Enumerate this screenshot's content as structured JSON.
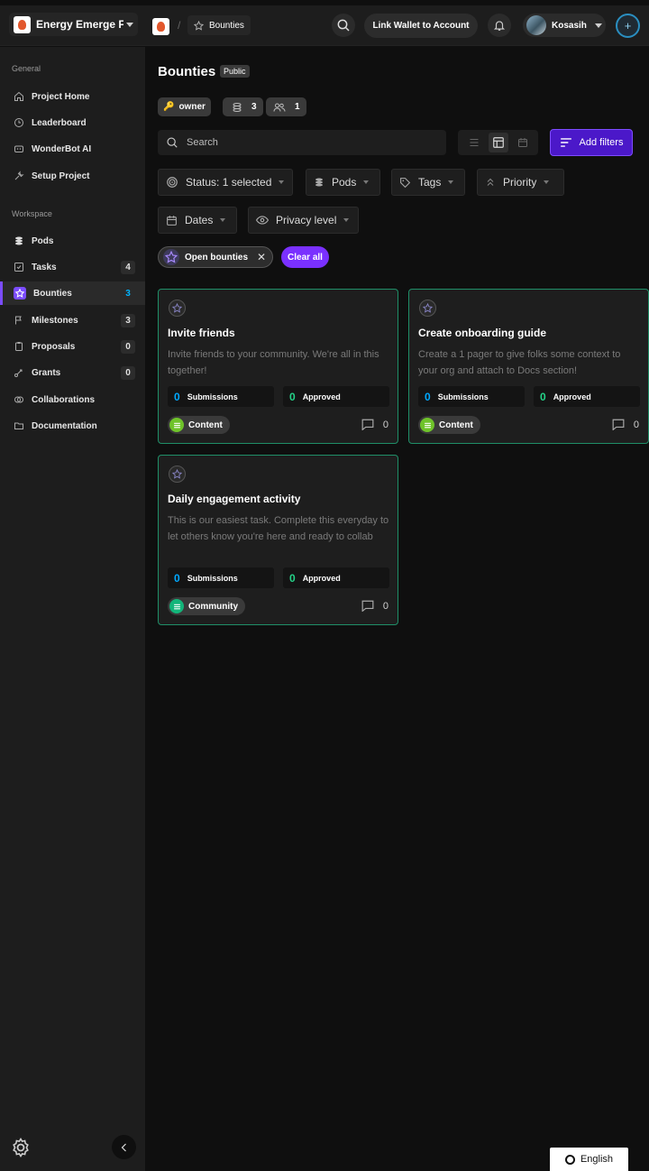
{
  "topbar": {
    "org_name": "Energy Emerge F...",
    "breadcrumb_current": "Bounties",
    "link_wallet_label": "Link Wallet to Account",
    "user_name": "Kosasih"
  },
  "sidebar": {
    "general_heading": "General",
    "general_items": [
      {
        "label": "Project Home",
        "icon": "home-icon"
      },
      {
        "label": "Leaderboard",
        "icon": "leaderboard-icon"
      },
      {
        "label": "WonderBot AI",
        "icon": "bot-icon"
      },
      {
        "label": "Setup Project",
        "icon": "wrench-icon"
      }
    ],
    "workspace_heading": "Workspace",
    "workspace_items": [
      {
        "label": "Pods",
        "icon": "pods-icon",
        "count": ""
      },
      {
        "label": "Tasks",
        "icon": "tasks-icon",
        "count": "4"
      },
      {
        "label": "Bounties",
        "icon": "star-icon",
        "count": "3"
      },
      {
        "label": "Milestones",
        "icon": "flag-icon",
        "count": "3"
      },
      {
        "label": "Proposals",
        "icon": "clipboard-icon",
        "count": "0"
      },
      {
        "label": "Grants",
        "icon": "grant-icon",
        "count": "0"
      },
      {
        "label": "Collaborations",
        "icon": "collab-icon",
        "count": ""
      },
      {
        "label": "Documentation",
        "icon": "folder-icon",
        "count": ""
      }
    ]
  },
  "header": {
    "title": "Bounties",
    "badge": "Public",
    "role_chip": "owner",
    "pods_count": "3",
    "members_count": "1"
  },
  "toolbar": {
    "search_placeholder": "Search",
    "add_filters_label": "Add filters"
  },
  "filters": {
    "status": "Status: 1 selected",
    "pods": "Pods",
    "tags": "Tags",
    "priority": "Priority",
    "dates": "Dates",
    "privacy": "Privacy level"
  },
  "active_filters": {
    "open_bounties": "Open bounties",
    "clear_all": "Clear all"
  },
  "cards": [
    {
      "title": "Invite friends",
      "description": "Invite friends to your community. We're all in this together!",
      "submissions": "0",
      "submissions_label": "Submissions",
      "approved": "0",
      "approved_label": "Approved",
      "tag": "Content",
      "tag_color": "#6fc32a",
      "comments": "0"
    },
    {
      "title": "Create onboarding guide",
      "description": "Create a 1 pager to give folks some context to your org and attach to Docs section!",
      "submissions": "0",
      "submissions_label": "Submissions",
      "approved": "0",
      "approved_label": "Approved",
      "tag": "Content",
      "tag_color": "#6fc32a",
      "comments": "0"
    },
    {
      "title": "Daily engagement activity",
      "description": "This is our easiest task. Complete this everyday to let others know you're here and ready to collab",
      "submissions": "0",
      "submissions_label": "Submissions",
      "approved": "0",
      "approved_label": "Approved",
      "tag": "Community",
      "tag_color": "#13b57a",
      "comments": "0"
    }
  ],
  "footer": {
    "language": "English"
  },
  "colors": {
    "accent": "#7a30ff",
    "card_border": "#1f8f68",
    "count_blue": "#00a9ff",
    "count_green": "#24d388"
  }
}
